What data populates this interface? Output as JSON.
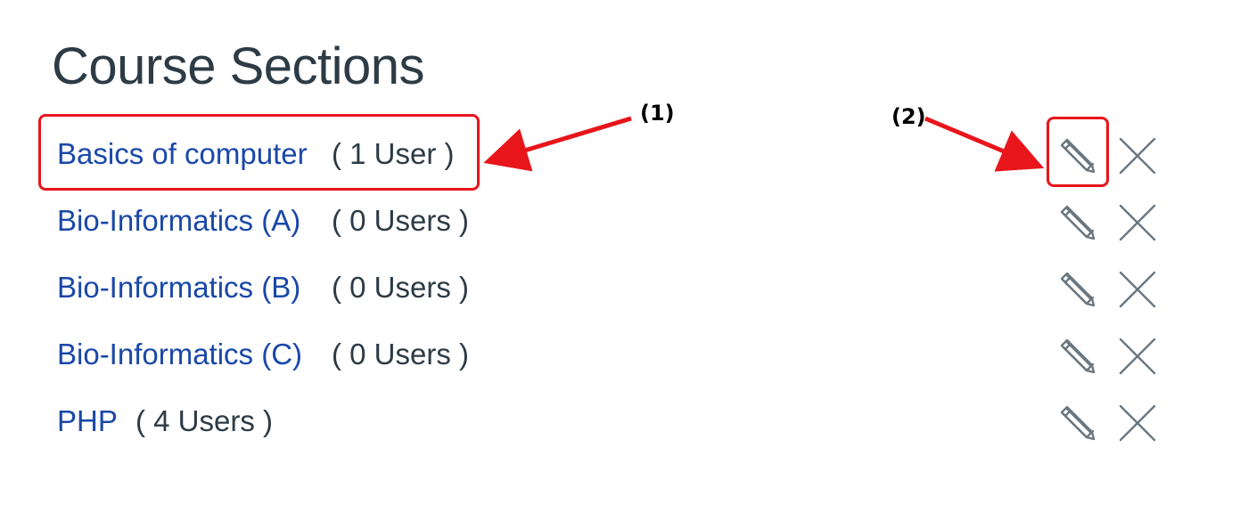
{
  "page": {
    "title": "Course Sections"
  },
  "sections": [
    {
      "name": "Basics of computer",
      "count": "( 1 User )"
    },
    {
      "name": "Bio-Informatics (A)",
      "count": "( 0 Users )"
    },
    {
      "name": "Bio-Informatics (B)",
      "count": "( 0 Users )"
    },
    {
      "name": "Bio-Informatics (C)",
      "count": "( 0 Users )"
    },
    {
      "name": "PHP",
      "count": "( 4 Users )"
    }
  ],
  "icons": {
    "edit": "pencil-icon",
    "delete": "close-icon"
  },
  "annotations": {
    "label_1": "(1)",
    "label_2": "(2)",
    "color": "#e8151b"
  },
  "colors": {
    "link": "#1a48a8",
    "text": "#2d3b45",
    "icon": "#6b7780"
  }
}
